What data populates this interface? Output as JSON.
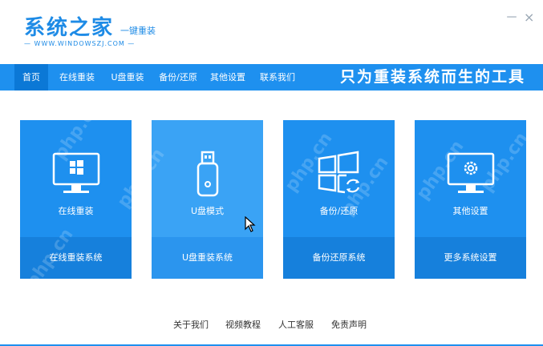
{
  "titlebar": {
    "logo_main": "系统之家",
    "logo_sub": "一键重装",
    "logo_url": "— WWW.WINDOWSZJ.COM —",
    "minimize_label": "－",
    "close_label": "×"
  },
  "nav": {
    "items": [
      {
        "label": "首页"
      },
      {
        "label": "在线重装"
      },
      {
        "label": "U盘重装"
      },
      {
        "label": "备份/还原"
      },
      {
        "label": "其他设置"
      },
      {
        "label": "联系我们"
      }
    ],
    "active_index": 0,
    "slogan": "只为重装系统而生的工具"
  },
  "cards": [
    {
      "title": "在线重装",
      "footer": "在线重装系统",
      "icon": "monitor-windows-icon"
    },
    {
      "title": "U盘模式",
      "footer": "U盘重装系统",
      "icon": "usb-drive-icon"
    },
    {
      "title": "备份/还原",
      "footer": "备份还原系统",
      "icon": "windows-restore-icon"
    },
    {
      "title": "其他设置",
      "footer": "更多系统设置",
      "icon": "monitor-gear-icon"
    }
  ],
  "footer_links": [
    {
      "label": "关于我们"
    },
    {
      "label": "视频教程"
    },
    {
      "label": "人工客服"
    },
    {
      "label": "免责声明"
    }
  ],
  "watermark": "php.cn",
  "colors": {
    "accent": "#1e90ef",
    "accent_dark": "#1680dc",
    "card_hover": "#3aa3f5"
  }
}
